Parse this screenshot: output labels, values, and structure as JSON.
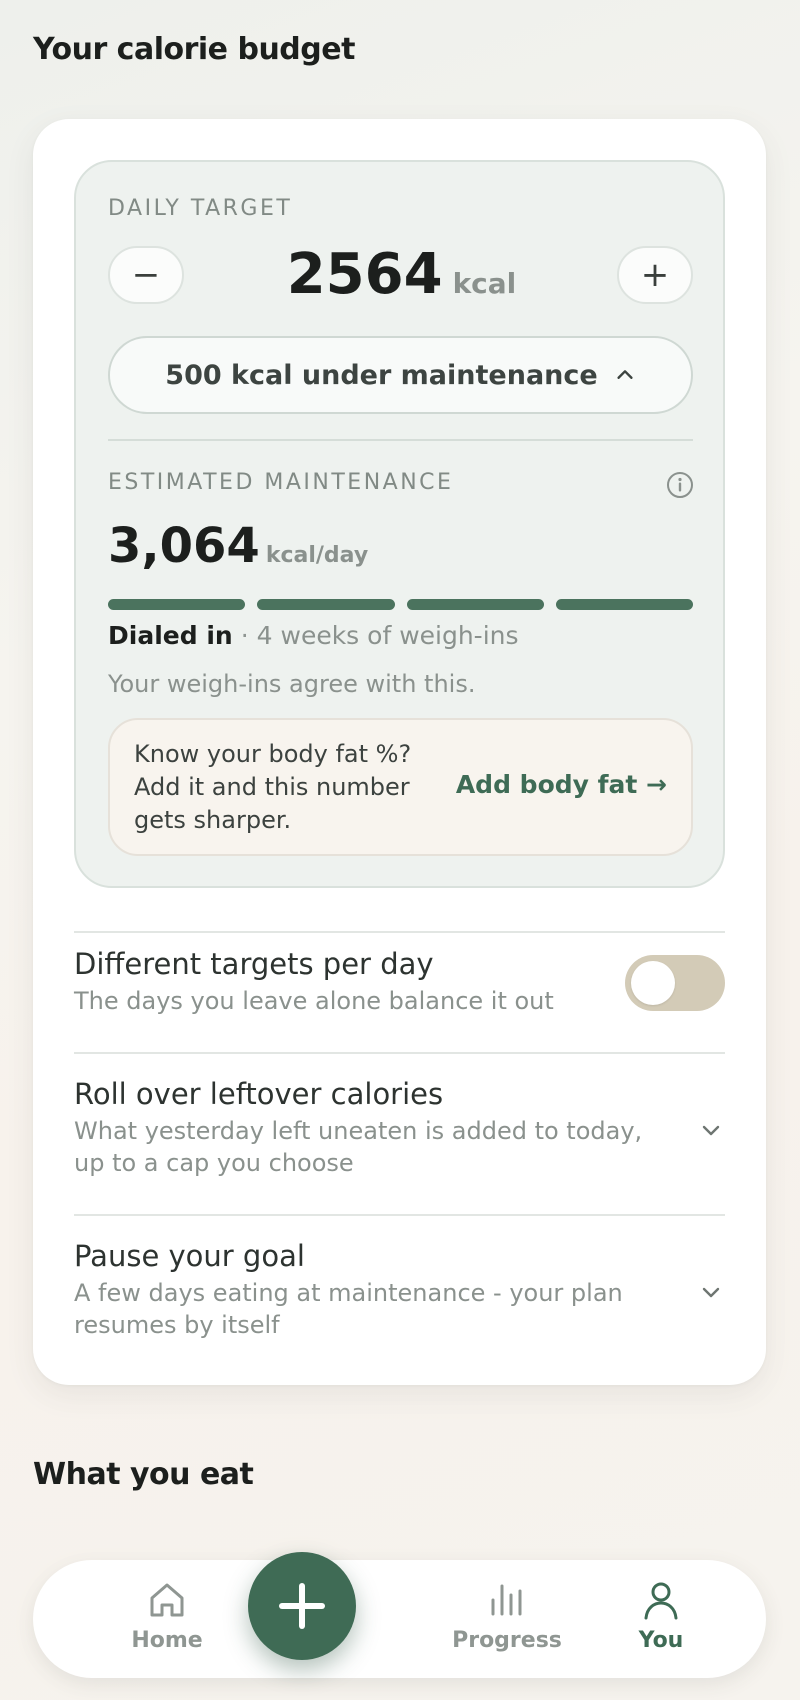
{
  "budget": {
    "section_title": "Your calorie budget",
    "daily_target": {
      "label": "DAILY TARGET",
      "value": "2564",
      "unit": "kcal",
      "decrement_label": "−",
      "increment_label": "+",
      "deficit_label": "500 kcal under maintenance"
    },
    "maintenance": {
      "label": "ESTIMATED MAINTENANCE",
      "value": "3,064",
      "unit": "kcal/day",
      "confidence_segments_filled": 4,
      "confidence_segments_total": 4,
      "status_strong": "Dialed in",
      "status_separator": "·",
      "status_detail": "4 weeks of weigh-ins",
      "note": "Your weigh-ins agree with this."
    },
    "body_fat_prompt": {
      "text": "Know your body fat %? Add it and this number gets sharper.",
      "link": "Add body fat →"
    },
    "settings": [
      {
        "title": "Different targets per day",
        "subtitle": "The days you leave alone balance it out",
        "control": "toggle",
        "enabled": false
      },
      {
        "title": "Roll over leftover calories",
        "subtitle": "What yesterday left uneaten is added to today, up to a cap you choose",
        "control": "chevron-down-icon"
      },
      {
        "title": "Pause your goal",
        "subtitle": "A few days eating at maintenance - your plan resumes by itself",
        "control": "chevron-down-icon"
      }
    ]
  },
  "eat": {
    "section_title": "What you eat"
  },
  "nav": {
    "items": [
      {
        "label": "Home",
        "icon": "home-icon",
        "active": false
      },
      {
        "label": "Progress",
        "icon": "bar-chart-icon",
        "active": false
      },
      {
        "label": "You",
        "icon": "person-icon",
        "active": true
      }
    ],
    "fab_icon": "plus-icon"
  },
  "colors": {
    "accent": "#3f6b55",
    "toggle_off": "#d3cbb7",
    "inner_panel": "#eef2ef",
    "body_fat_box": "#f8f4ee"
  }
}
